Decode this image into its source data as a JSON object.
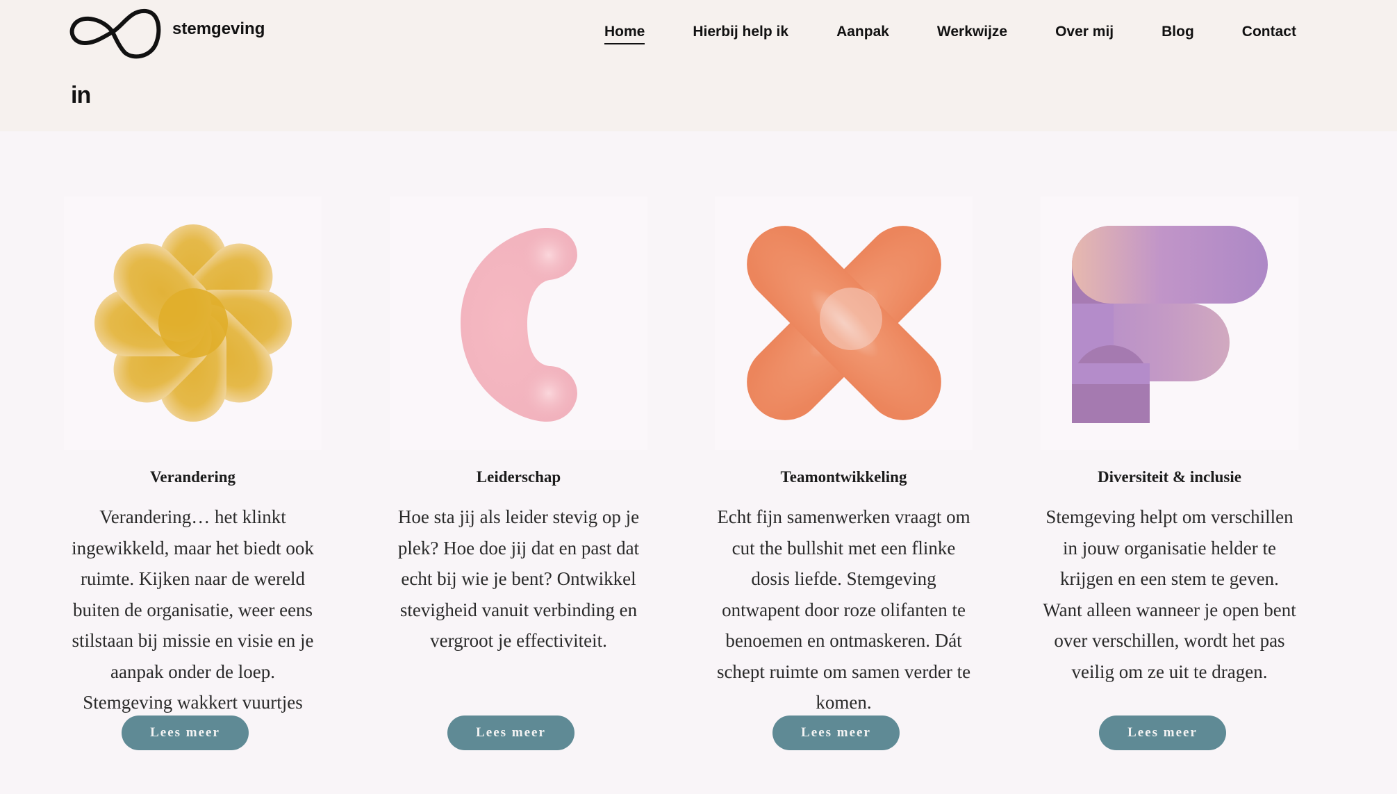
{
  "brand": {
    "name": "stemgeving"
  },
  "social": {
    "linkedin": "in"
  },
  "nav": {
    "items": [
      {
        "label": "Home",
        "active": true
      },
      {
        "label": "Hierbij help ik"
      },
      {
        "label": "Aanpak"
      },
      {
        "label": "Werkwijze"
      },
      {
        "label": "Over mij"
      },
      {
        "label": "Blog"
      },
      {
        "label": "Contact"
      }
    ]
  },
  "cards": [
    {
      "title": "Verandering",
      "text": "Verandering… het klinkt ingewikkeld, maar het biedt ook ruimte. Kijken naar de wereld buiten de organisatie, weer eens stilstaan bij missie en visie en je aanpak onder de loep. Stemgeving wakkert vuurtjes weer aan.",
      "button": "Lees meer",
      "icon": "flower-icon",
      "color": "#e0b233"
    },
    {
      "title": "Leiderschap",
      "text": "Hoe sta jij als leider stevig op je plek? Hoe doe jij dat en past dat echt bij wie je bent? Ontwikkel stevigheid vanuit verbinding en vergroot je effectiviteit.",
      "button": "Lees meer",
      "icon": "crescent-icon",
      "color": "#f4bcc4"
    },
    {
      "title": "Teamontwikkeling",
      "text": "Echt fijn samenwerken vraagt om cut the bullshit met een flinke dosis liefde. Stemgeving ontwapent door roze olifanten te benoemen en ontmaskeren. Dát schept ruimte om samen verder te komen.",
      "button": "Lees meer",
      "icon": "cross-icon",
      "color": "#ef8a63"
    },
    {
      "title": "Diversiteit & inclusie",
      "text": "Stemgeving helpt om verschillen in jouw organisatie helder te krijgen en een stem te geven. Want alleen wanneer je open bent over verschillen, wordt het pas veilig om ze uit te dragen.",
      "button": "Lees meer",
      "icon": "letter-f-icon",
      "color": "#b48ac9"
    }
  ],
  "colors": {
    "header_bg": "#f6f1ee",
    "page_bg": "#f9f5f8",
    "button_bg": "#5f8a95"
  }
}
